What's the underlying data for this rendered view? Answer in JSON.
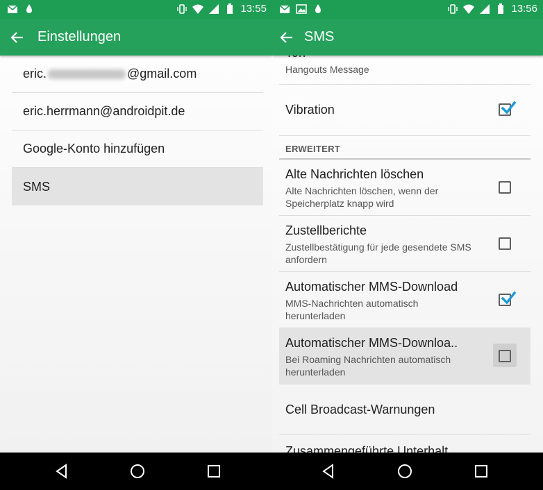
{
  "left": {
    "status": {
      "clock": "13:55"
    },
    "toolbar": {
      "title": "Einstellungen"
    },
    "accounts": [
      {
        "prefix": "eric.",
        "suffix": "@gmail.com"
      },
      {
        "label": "eric.herrmann@androidpit.de"
      },
      {
        "label": "Google-Konto hinzufügen"
      },
      {
        "label": "SMS"
      }
    ]
  },
  "right": {
    "status": {
      "clock": "13:56"
    },
    "toolbar": {
      "title": "SMS"
    },
    "partial_row": {
      "title": "Ton",
      "sub": "Hangouts Message"
    },
    "vibration": {
      "title": "Vibration",
      "checked": true
    },
    "section": "ERWEITERT",
    "items": [
      {
        "title": "Alte Nachrichten löschen",
        "sub": "Alte Nachrichten löschen, wenn der Speicherplatz knapp wird",
        "checked": false
      },
      {
        "title": "Zustellberichte",
        "sub": "Zustellbestätigung für jede gesendete SMS anfordern",
        "checked": false
      },
      {
        "title": "Automatischer MMS-Download",
        "sub": "MMS-Nachrichten automatisch herunterladen",
        "checked": true
      },
      {
        "title": "Automatischer MMS-Downloa..",
        "sub": "Bei Roaming Nachrichten automatisch herunterladen",
        "checked": false
      }
    ],
    "cell_broadcast": "Cell Broadcast-Warnungen",
    "last_row": "Zusammengeführte Unterhalt.."
  },
  "colors": {
    "status_bar": "#1e9e55",
    "toolbar": "#25a15c",
    "check_accent": "#1a9ad6"
  }
}
